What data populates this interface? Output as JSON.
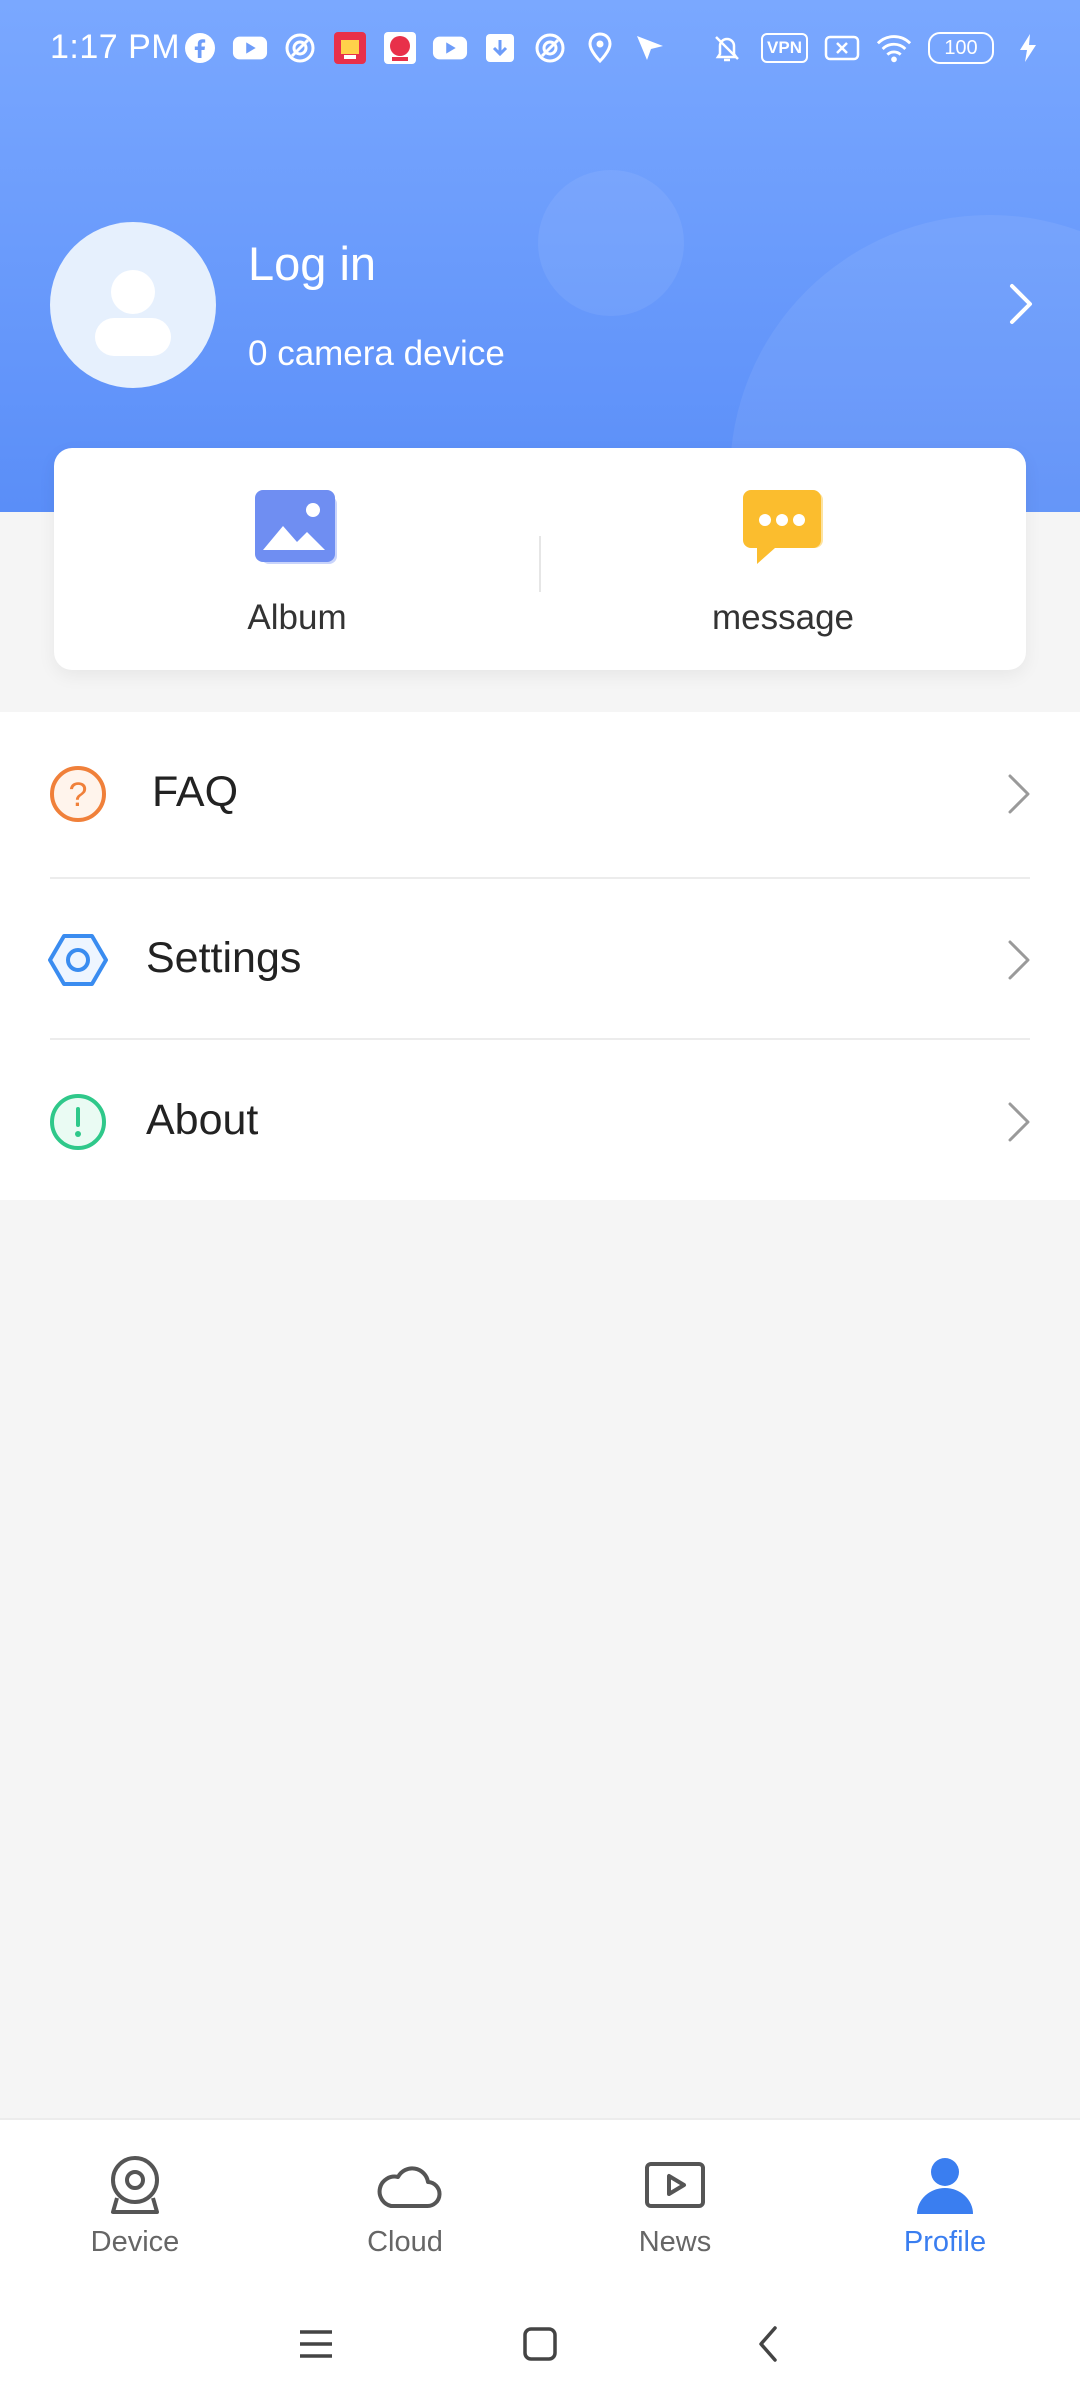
{
  "status_bar": {
    "time": "1:17 PM",
    "vpn_label": "VPN",
    "battery": "100",
    "notification_icons": [
      "facebook-icon",
      "youtube-icon",
      "vpn-app-icon",
      "red-app-icon",
      "red-app-icon-2",
      "youtube-icon",
      "download-icon",
      "vpn-app-icon",
      "location-icon",
      "send-icon"
    ],
    "system_icons": [
      "bell-muted-icon",
      "vpn-icon",
      "no-sim-icon",
      "wifi-icon",
      "battery-icon",
      "charging-icon"
    ]
  },
  "profile": {
    "title": "Log in",
    "subtitle": "0 camera device"
  },
  "quick_actions": [
    {
      "label": "Album",
      "icon": "album-icon"
    },
    {
      "label": "message",
      "icon": "message-icon"
    }
  ],
  "menu": [
    {
      "label": "FAQ",
      "icon": "faq-icon"
    },
    {
      "label": "Settings",
      "icon": "settings-icon"
    },
    {
      "label": "About",
      "icon": "about-icon"
    }
  ],
  "bottom_nav": [
    {
      "label": "Device",
      "icon": "camera-device-icon",
      "active": false
    },
    {
      "label": "Cloud",
      "icon": "cloud-icon",
      "active": false
    },
    {
      "label": "News",
      "icon": "news-play-icon",
      "active": false
    },
    {
      "label": "Profile",
      "icon": "profile-icon",
      "active": true
    }
  ],
  "colors": {
    "header_top": "#7aa8ff",
    "header_bottom": "#5a8ef8",
    "accent": "#3a7ef0",
    "faq": "#f0803a",
    "settings": "#3a8cf0",
    "about": "#2fc88a",
    "message": "#fbbd2e",
    "album": "#6a8af0"
  }
}
